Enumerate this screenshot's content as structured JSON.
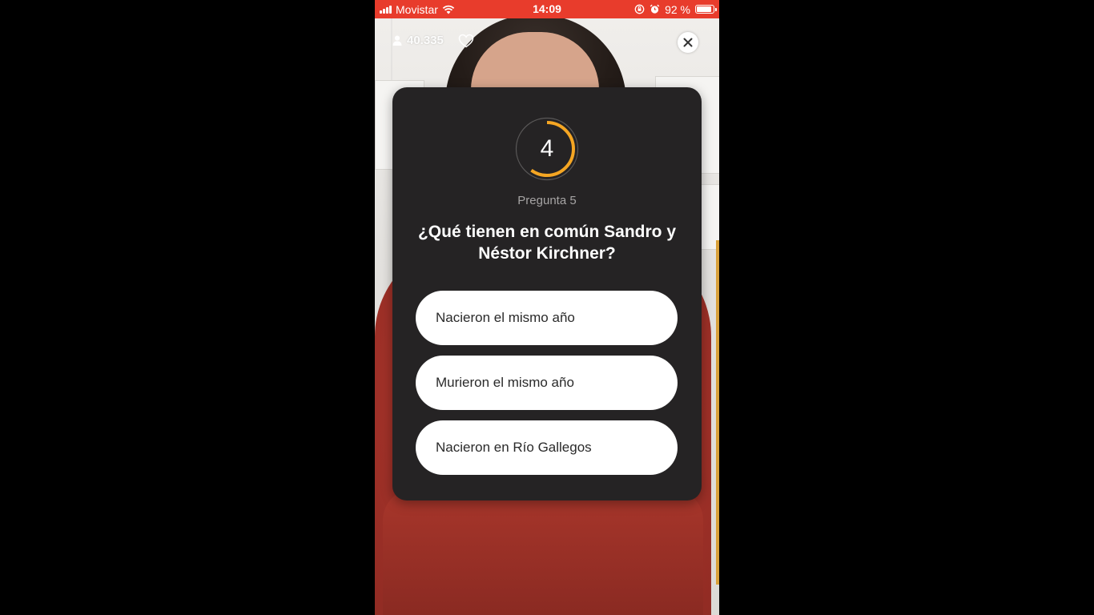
{
  "status_bar": {
    "carrier": "Movistar",
    "time": "14:09",
    "battery_text": "92 %",
    "battery_level": 0.92,
    "color": "#e83c2c"
  },
  "live": {
    "viewer_count": "40.335"
  },
  "question": {
    "timer_value": "4",
    "timer_progress": 0.6,
    "timer_color": "#f5a623",
    "number_label": "Pregunta 5",
    "text": "¿Qué tienen en común Sandro y Néstor Kirchner?",
    "options": [
      {
        "label": "Nacieron el mismo año"
      },
      {
        "label": "Murieron el mismo año"
      },
      {
        "label": "Nacieron en Río Gallegos"
      }
    ]
  },
  "icons": {
    "viewers": "user-icon",
    "like": "heart-icon",
    "close": "close-icon",
    "wifi": "wifi-icon",
    "signal": "signal-icon",
    "alarm": "alarm-icon",
    "lock": "rotation-lock-icon",
    "battery": "battery-icon"
  }
}
